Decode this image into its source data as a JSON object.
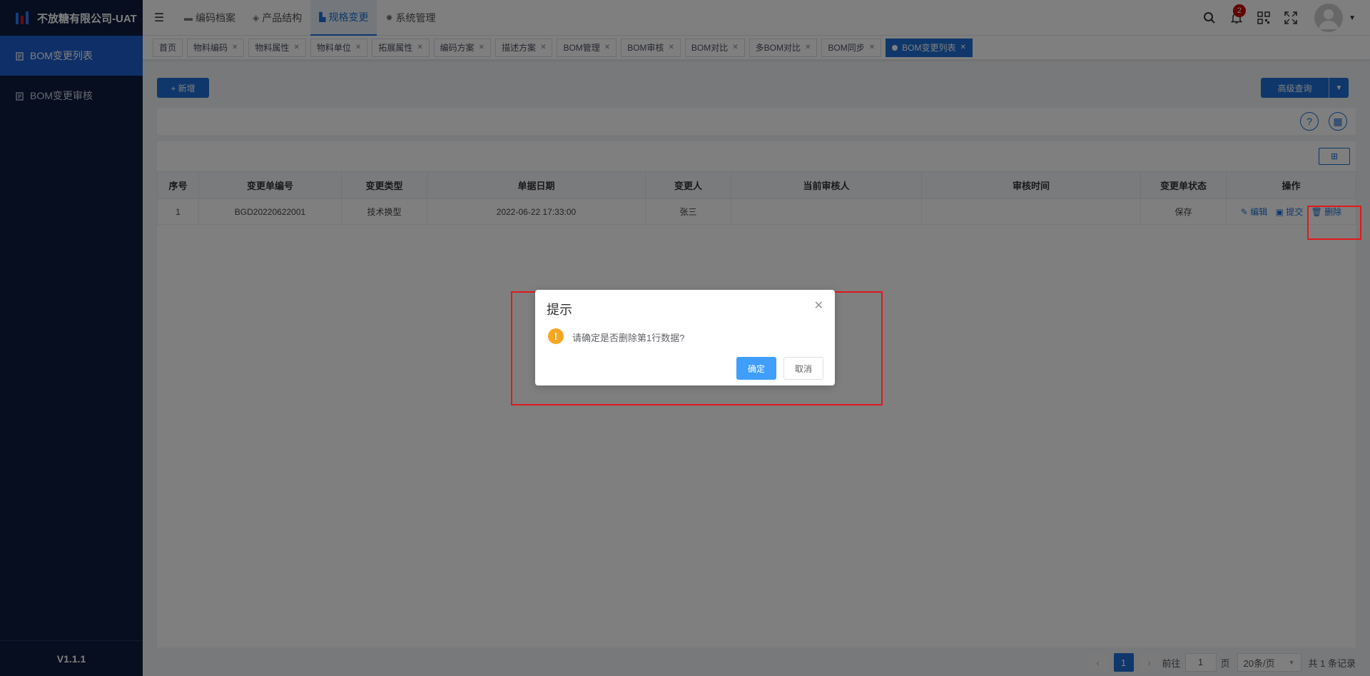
{
  "app": {
    "title": "不放糖有限公司-UAT",
    "version": "V1.1.1"
  },
  "sidebar": {
    "items": [
      {
        "label": "BOM变更列表",
        "active": true
      },
      {
        "label": "BOM变更审核",
        "active": false
      }
    ]
  },
  "header": {
    "fold_icon": "menu-fold-icon",
    "nav": [
      {
        "label": "编码档案",
        "icon": "folder-icon"
      },
      {
        "label": "产品结构",
        "icon": "layers-icon"
      },
      {
        "label": "规格变更",
        "icon": "chart-icon"
      },
      {
        "label": "系统管理",
        "icon": "gear-icon"
      }
    ],
    "notification_count": "2",
    "colors": {
      "accent": "#1f6fd6",
      "sidebar": "#0c1d3f",
      "badge": "#c40000"
    }
  },
  "tags": [
    {
      "label": "首页",
      "closable": false
    },
    {
      "label": "物料编码",
      "closable": true
    },
    {
      "label": "物料属性",
      "closable": true
    },
    {
      "label": "物料单位",
      "closable": true
    },
    {
      "label": "拓展属性",
      "closable": true
    },
    {
      "label": "编码方案",
      "closable": true
    },
    {
      "label": "描述方案",
      "closable": true
    },
    {
      "label": "BOM管理",
      "closable": true
    },
    {
      "label": "BOM审核",
      "closable": true
    },
    {
      "label": "BOM对比",
      "closable": true
    },
    {
      "label": "多BOM对比",
      "closable": true
    },
    {
      "label": "BOM同步",
      "closable": true
    },
    {
      "label": "BOM变更列表",
      "closable": true,
      "active": true
    }
  ],
  "toolbar": {
    "add_label": "+ 新增",
    "advanced_label": "高级查询"
  },
  "table": {
    "columns": [
      "序号",
      "变更单编号",
      "变更类型",
      "单据日期",
      "变更人",
      "当前审核人",
      "审核时间",
      "变更单状态",
      "操作"
    ],
    "rows": [
      {
        "index": "1",
        "code": "BGD20220622001",
        "type": "技术换型",
        "date": "2022-06-22 17:33:00",
        "person": "张三",
        "reviewer": "",
        "review_time": "",
        "status": "保存",
        "actions": {
          "edit": "编辑",
          "submit": "提交",
          "delete": "删除"
        }
      }
    ]
  },
  "pagination": {
    "current_page": "1",
    "goto_label": "前往",
    "goto_value": "1",
    "page_unit": "页",
    "page_size": "20条/页",
    "total": "共 1 条记录"
  },
  "dialog": {
    "title": "提示",
    "message": "请确定是否删除第1行数据?",
    "ok_label": "确定",
    "cancel_label": "取消"
  }
}
